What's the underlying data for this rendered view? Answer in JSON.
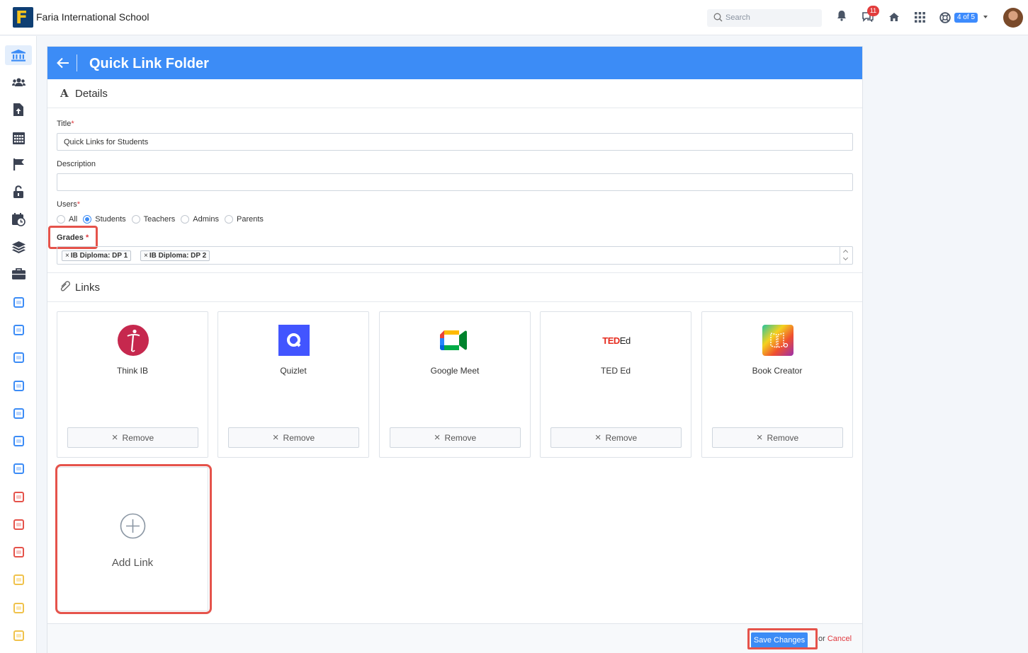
{
  "header": {
    "school_name": "Faria International School",
    "search_placeholder": "Search",
    "notification_count": "11",
    "account_pill": "4 of 5"
  },
  "sidebar": {
    "apps": [
      {
        "name": "institution",
        "color": "#3c8cf6"
      },
      {
        "name": "users",
        "color": "#3b4252"
      },
      {
        "name": "file-upload",
        "color": "#3b4252"
      },
      {
        "name": "calendar-grid",
        "color": "#3b4252"
      },
      {
        "name": "flag",
        "color": "#3b4252"
      },
      {
        "name": "unlock",
        "color": "#3b4252"
      },
      {
        "name": "calendar-clock",
        "color": "#3b4252"
      },
      {
        "name": "layers",
        "color": "#3b4252"
      },
      {
        "name": "briefcase",
        "color": "#3b4252"
      },
      {
        "name": "app-dp",
        "color": "#3c8cf6"
      },
      {
        "name": "app-cp",
        "color": "#3c8cf6"
      },
      {
        "name": "app-myp",
        "color": "#3c8cf6"
      },
      {
        "name": "app-pyp",
        "color": "#3c8cf6"
      },
      {
        "name": "app-ed1",
        "color": "#3c8cf6"
      },
      {
        "name": "app-ed2",
        "color": "#3c8cf6"
      },
      {
        "name": "app-ed3",
        "color": "#3c8cf6"
      },
      {
        "name": "app-red1",
        "color": "#e5534b"
      },
      {
        "name": "app-red2",
        "color": "#e5534b"
      },
      {
        "name": "app-red3",
        "color": "#e5534b"
      },
      {
        "name": "app-yellow1",
        "color": "#f0c24b"
      },
      {
        "name": "app-yellow2",
        "color": "#f0c24b"
      },
      {
        "name": "app-yellow3",
        "color": "#f0c24b"
      }
    ]
  },
  "page": {
    "title": "Quick Link Folder",
    "details_section": "Details",
    "links_section": "Links"
  },
  "form": {
    "title_label": "Title",
    "title_value": "Quick Links for Students",
    "description_label": "Description",
    "description_value": "",
    "users_label": "Users",
    "users_options": [
      "All",
      "Students",
      "Teachers",
      "Admins",
      "Parents"
    ],
    "users_selected": "Students",
    "grades_label": "Grades",
    "grades": [
      "IB Diploma: DP 1",
      "IB Diploma: DP 2"
    ],
    "required_mark": "*"
  },
  "links": [
    {
      "name": "Think IB",
      "remove_label": "Remove"
    },
    {
      "name": "Quizlet",
      "remove_label": "Remove"
    },
    {
      "name": "Google Meet",
      "remove_label": "Remove"
    },
    {
      "name": "TED Ed",
      "remove_label": "Remove",
      "logo_text": "TED",
      "logo_suffix": "Ed"
    },
    {
      "name": "Book Creator",
      "remove_label": "Remove"
    }
  ],
  "add_link_label": "Add Link",
  "footer": {
    "save_label": "Save Changes",
    "or_text": "or",
    "cancel_label": "Cancel"
  },
  "colors": {
    "accent": "#3c8cf6",
    "highlight": "#e5534b",
    "required": "#e0393e"
  }
}
